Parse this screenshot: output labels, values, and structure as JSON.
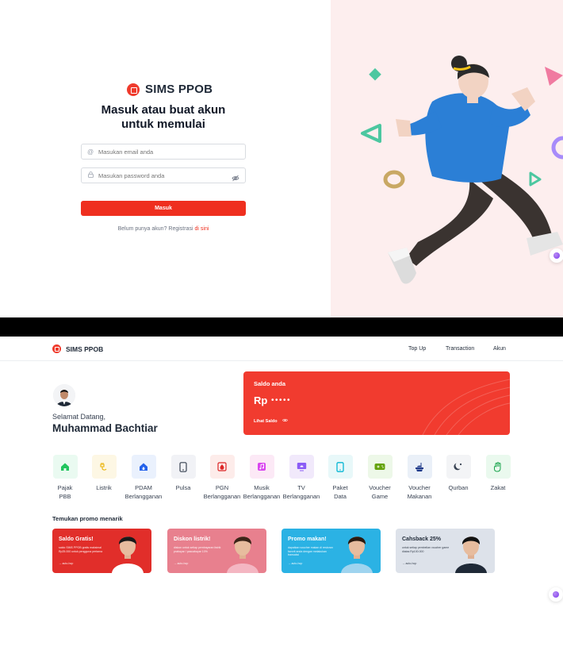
{
  "login": {
    "brand": "SIMS PPOB",
    "title_line1": "Masuk atau buat akun",
    "title_line2": "untuk memulai",
    "email_placeholder": "Masukan email anda",
    "password_placeholder": "Masukan password anda",
    "submit_label": "Masuk",
    "register_prompt": "Belum punya akun? Registrasi",
    "register_link": "di sini"
  },
  "nav": {
    "brand": "SIMS PPOB",
    "links": [
      "Top Up",
      "Transaction",
      "Akun"
    ]
  },
  "profile": {
    "greeting": "Selamat Datang,",
    "name": "Muhammad Bachtiar"
  },
  "saldo": {
    "label": "Saldo anda",
    "currency": "Rp",
    "masked": "•••••",
    "toggle": "Lihat Saldo"
  },
  "services": [
    {
      "line1": "Pajak",
      "line2": "PBB",
      "icon": "house-icon",
      "bg": "#eafaf1",
      "fg": "#22c55e"
    },
    {
      "line1": "Listrik",
      "line2": "",
      "icon": "electric-plug-icon",
      "bg": "#fdf7e4",
      "fg": "#eab308"
    },
    {
      "line1": "PDAM",
      "line2": "Berlangganan",
      "icon": "water-house-icon",
      "bg": "#eaf1fd",
      "fg": "#2563eb"
    },
    {
      "line1": "Pulsa",
      "line2": "",
      "icon": "phone-icon",
      "bg": "#f1f2f6",
      "fg": "#374151"
    },
    {
      "line1": "PGN",
      "line2": "Berlangganan",
      "icon": "gas-flame-icon",
      "bg": "#fdecea",
      "fg": "#dc2626"
    },
    {
      "line1": "Musik",
      "line2": "Berlangganan",
      "icon": "music-icon",
      "bg": "#fce9f6",
      "fg": "#d946ef"
    },
    {
      "line1": "TV",
      "line2": "Berlangganan",
      "icon": "tv-icon",
      "bg": "#f1e9fb",
      "fg": "#8b5cf6"
    },
    {
      "line1": "Paket",
      "line2": "Data",
      "icon": "smartphone-icon",
      "bg": "#e8f8f9",
      "fg": "#06b6d4"
    },
    {
      "line1": "Voucher",
      "line2": "Game",
      "icon": "gamepad-icon",
      "bg": "#edf8e8",
      "fg": "#65a30d"
    },
    {
      "line1": "Voucher",
      "line2": "Makanan",
      "icon": "food-icon",
      "bg": "#eaf0f8",
      "fg": "#1e3a8a"
    },
    {
      "line1": "Qurban",
      "line2": "",
      "icon": "moon-icon",
      "bg": "#f3f4f6",
      "fg": "#374151"
    },
    {
      "line1": "Zakat",
      "line2": "",
      "icon": "hand-icon",
      "bg": "#eaf9ee",
      "fg": "#16a34a"
    }
  ],
  "promo_section_title": "Temukan promo menarik",
  "promos": [
    {
      "title": "Saldo Gratis!",
      "text": "saldo SIMS PPOB gratis maksimal Rp25.000 untuk pengguna pertama",
      "footer": "→ auto-hop",
      "bg": "#e12e2a"
    },
    {
      "title": "Diskon listrik!",
      "text": "diskon untuk setiap pembayaran listrik prabayar / pascabayar 10%",
      "footer": "→ auto-hop",
      "bg": "#e8808e"
    },
    {
      "title": "Promo makan!",
      "text": "dapatkan voucher makan di restoran favorit anda dengan melakukan transaksi",
      "footer": "→ auto-hop",
      "bg": "#2bb2e4"
    },
    {
      "title": "Cahsback 25%",
      "text": "untuk setiap pembelian voucher game diatas Rp100.000",
      "footer": "→ auto-hop",
      "bg": "#dde2ea"
    }
  ],
  "colors": {
    "brand_red": "#ef2f1f",
    "hero_bg": "#fdeeee"
  }
}
